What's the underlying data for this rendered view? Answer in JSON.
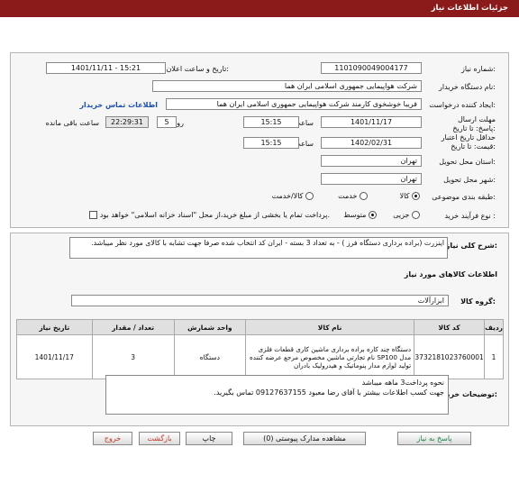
{
  "header": {
    "title": "جزئیات اطلاعات نیاز"
  },
  "fields": {
    "need_number_label": "شماره نیاز:",
    "need_number": "1101090049004177",
    "announce_label": "تاریخ و ساعت اعلان عمومی:",
    "announce_value": "1401/11/11 - 15:21",
    "buyer_org_label": "نام دستگاه خریدار:",
    "buyer_org": "شرکت هواپیمایی جمهوری اسلامی ایران هما",
    "creator_label": "ایجاد کننده درخواست:",
    "creator": "فریبا خوشخوی کارمند شرکت هواپیمایی جمهوری اسلامی ایران هما",
    "contact_link": "اطلاعات تماس خریدار",
    "deadline_label": "مهلت ارسال پاسخ: تا تاریخ:",
    "deadline_date": "1401/11/17",
    "time_label": "ساعت",
    "deadline_time": "15:15",
    "days_value": "5",
    "day_and_label": "روز و",
    "remaining_time": "22:29:31",
    "remaining_label": "ساعت باقی مانده",
    "validity_label": "حداقل تاریخ اعتبار قیمت: تا تاریخ:",
    "validity_date": "1402/02/31",
    "validity_time": "15:15",
    "province_label": "استان محل تحویل:",
    "province": "تهران",
    "city_label": "شهر محل تحویل:",
    "city": "تهران",
    "category_label": "طبقه بندی موضوعی:",
    "category_options": [
      "کالا",
      "خدمت",
      "کالا/خدمت"
    ],
    "process_label": "نوع فرآیند خرید :",
    "process_options": [
      "جزیی",
      "متوسط"
    ],
    "payment_note": "پرداخت تمام یا بخشی از مبلغ خرید،از محل \"اسناد خزانه اسلامی\" خواهد بود."
  },
  "summary": {
    "label": "شرح کلی نیاز:",
    "text": "اینزرت (براده برداری دستگاه فرز ) - به تعداد 3 بسته - ایران کد انتخاب شده صرفا جهت تشابه با کالای مورد نظر میباشد."
  },
  "goods": {
    "section_title": "اطلاعات کالاهای مورد نیاز",
    "group_label": "گروه کالا:",
    "group_value": "ابزارآلات",
    "headers": [
      "ردیف",
      "کد کالا",
      "نام کالا",
      "واحد شمارش",
      "تعداد / مقدار",
      "تاریخ نیاز"
    ],
    "rows": [
      {
        "index": "1",
        "code": "3732181023760001",
        "name": "دستگاه چند کاره براده برداری ماشین کاری قطعات فلزی مدل SP100 نام تجارتی ماشین مخصوص مرجع عرضه کننده تولید لوازم مدار پنوماتیک و هیدرولیک بادران",
        "unit": "دستگاه",
        "qty": "3",
        "date": "1401/11/17"
      }
    ]
  },
  "buyer_notes": {
    "label": "توضیحات خریدار:",
    "line1": "نحوه پرداخت3 ماهه میباشد",
    "line2": "جهت کسب اطلاعات بیشتر با آقای رضا معبود 09127637155 تماس بگیرید."
  },
  "buttons": {
    "reply": "پاسخ به نیاز",
    "attachments": "مشاهده مدارک پیوستی (0)",
    "print": "چاپ",
    "back": "بازگشت",
    "exit": "خروج"
  }
}
